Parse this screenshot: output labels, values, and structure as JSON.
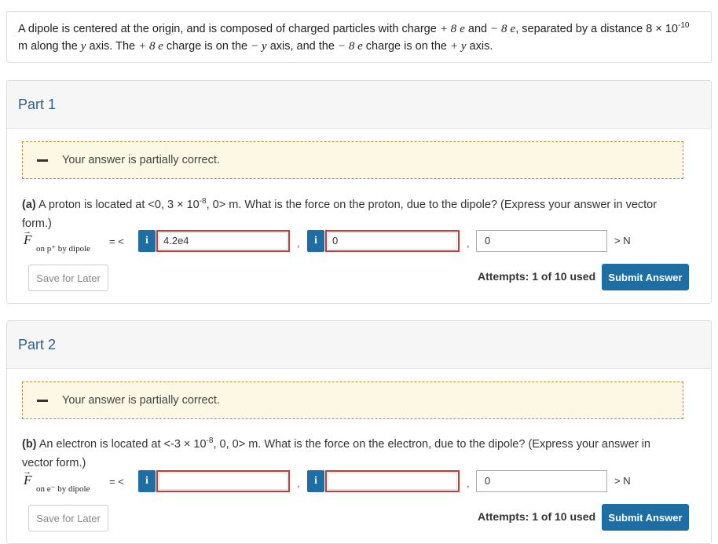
{
  "problem": {
    "line1_a": "A dipole is centered at the origin, and is composed of charged particles with charge ",
    "charge_pos": "+ 8",
    "e1": "e",
    "and": " and ",
    "charge_neg": "− 8",
    "e2": "e",
    "line1_b": ", separated by a distance 8 × 10",
    "exp": "-10",
    "line2_a": " m along the ",
    "yaxis": "y",
    "line2_b": " axis. The ",
    "pos_text": "+ 8 e",
    "line2_c": " charge is on the ",
    "neg_axis": "− y",
    "line2_d": " axis, and the ",
    "neg_text": "− 8 e",
    "line2_e": " charge is on the ",
    "pos_axis": "+ y",
    "line2_f": " axis."
  },
  "parts": [
    {
      "title": "Part 1",
      "feedback": "Your answer is partially correct.",
      "question_label": "(a)",
      "question_a": " A proton is located at <0, 3 × 10",
      "question_exp": "-8",
      "question_b": ", 0> m. What is the force on the proton, due to the dipole? (Express your answer in vector form.)",
      "vector_symbol": "F",
      "vector_sub": "on p⁺ by dipole",
      "open": "= <",
      "info": "i",
      "x_value": "4.2e4",
      "y_value": "0",
      "z_value": "0",
      "comma": ",",
      "unit": "> N",
      "save_label": "Save for Later",
      "attempts": "Attempts: 1 of 10 used",
      "submit_label": "Submit Answer"
    },
    {
      "title": "Part 2",
      "feedback": "Your answer is partially correct.",
      "question_label": "(b)",
      "question_a": " An electron is located at <-3 × 10",
      "question_exp": "-8",
      "question_b": ", 0, 0> m. What is the force on the electron, due to the dipole? (Express your answer in vector form.)",
      "vector_symbol": "F",
      "vector_sub": "on e⁻ by dipole",
      "open": "= <",
      "info": "i",
      "x_value": "",
      "y_value": "",
      "z_value": "0",
      "comma": ",",
      "unit": "> N",
      "save_label": "Save for Later",
      "attempts": "Attempts: 1 of 10 used",
      "submit_label": "Submit Answer"
    }
  ],
  "colors": {
    "accent": "#1f6ea3",
    "error": "#c23b3b",
    "feedback_bg": "#fcf8e3"
  }
}
